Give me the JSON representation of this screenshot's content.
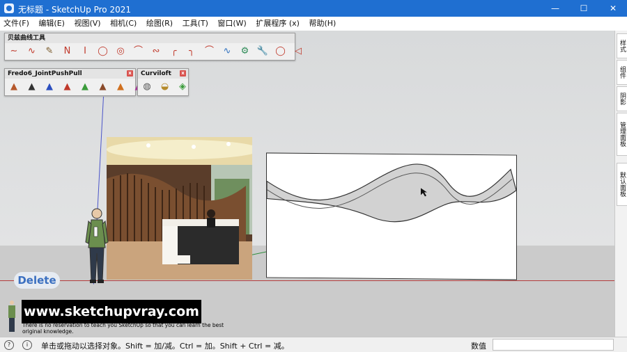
{
  "window": {
    "title": "无标题 - SketchUp Pro 2021",
    "minimize": "—",
    "maximize": "☐",
    "close": "✕"
  },
  "menu": [
    "文件(F)",
    "编辑(E)",
    "视图(V)",
    "相机(C)",
    "绘图(R)",
    "工具(T)",
    "窗口(W)",
    "扩展程序 (x)",
    "帮助(H)"
  ],
  "toolbars": {
    "bezier": {
      "title": "贝兹曲线工具",
      "close": "x",
      "tools": [
        "∼",
        "∿",
        "✎",
        "Ν",
        "I",
        "◯",
        "◎",
        "⌒",
        "∾",
        "╭",
        "╮",
        "⌒",
        "∿",
        "⚙",
        "🔧",
        "◯",
        "◁"
      ]
    },
    "fredo": {
      "title": "Fredo6_JointPushPull",
      "close": "x",
      "tools": [
        "▲",
        "▲",
        "▲",
        "▲",
        "▲",
        "▲",
        "▲",
        "▲"
      ]
    },
    "curviloft": {
      "title": "Curviloft",
      "close": "x",
      "tools": [
        "◍",
        "◒",
        "◈"
      ]
    }
  },
  "overlay": {
    "delete_label": "Delete",
    "website": "www.sketchupvray.com",
    "note": "There is no reservation to teach you SketchUp so that you can learn the best original knowledge."
  },
  "right_panel_tabs": [
    "样式",
    "组件",
    "阴影",
    "管理面板",
    "默认面板"
  ],
  "status": {
    "message": "单击或拖动以选择对象。Shift = 加/减。Ctrl = 加。Shift + Ctrl = 减。",
    "value_label": "数值",
    "value": ""
  },
  "colors": {
    "titlebar": "#1f6fd1",
    "red_axis": "#b33a3a",
    "blue_axis": "#4a54c9",
    "green_axis": "#2c8d3a"
  }
}
